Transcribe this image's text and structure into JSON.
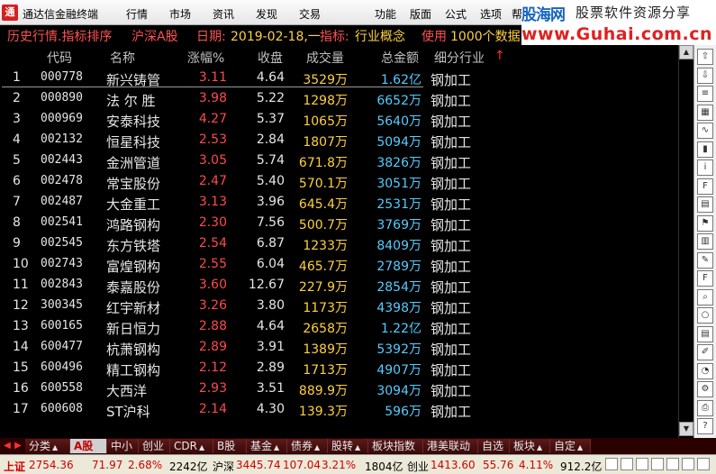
{
  "app": {
    "title": "通达信金融终端",
    "logo_glyph": "通"
  },
  "menu": [
    "行情",
    "市场",
    "资讯",
    "发现",
    "交易",
    "功能",
    "版面",
    "公式",
    "选项",
    "帮"
  ],
  "watermark": {
    "logo_a": "股海网",
    "logo_b": "股票软件资源分享",
    "url": "www.Guhai.com.cn"
  },
  "titlebar": {
    "section": "历史行情.指标排序",
    "market": "沪深A股",
    "date_label": "日期:",
    "date_value": "2019-02-18,一",
    "indicator_label": "指标:",
    "indicator_value": "行业概念",
    "usage_label": "使用",
    "usage_value": "1000个数据"
  },
  "columns": {
    "code": "代码",
    "name": "名称",
    "change": "涨幅%",
    "close": "收盘",
    "volume": "成交量",
    "amount": "总金额",
    "industry": "细分行业",
    "sort_marker": "↑"
  },
  "rows": [
    {
      "idx": "1",
      "code": "000778",
      "name": "新兴铸管",
      "change": "3.11",
      "close": "4.64",
      "volume": "3529万",
      "amount": "1.62亿",
      "industry": "钢加工"
    },
    {
      "idx": "2",
      "code": "000890",
      "name": "法 尔 胜",
      "change": "3.98",
      "close": "5.22",
      "volume": "1298万",
      "amount": "6652万",
      "industry": "钢加工"
    },
    {
      "idx": "3",
      "code": "000969",
      "name": "安泰科技",
      "change": "4.27",
      "close": "5.37",
      "volume": "1065万",
      "amount": "5640万",
      "industry": "钢加工"
    },
    {
      "idx": "4",
      "code": "002132",
      "name": "恒星科技",
      "change": "2.53",
      "close": "2.84",
      "volume": "1807万",
      "amount": "5094万",
      "industry": "钢加工"
    },
    {
      "idx": "5",
      "code": "002443",
      "name": "金洲管道",
      "change": "3.05",
      "close": "5.74",
      "volume": "671.8万",
      "amount": "3826万",
      "industry": "钢加工"
    },
    {
      "idx": "6",
      "code": "002478",
      "name": "常宝股份",
      "change": "2.47",
      "close": "5.40",
      "volume": "570.1万",
      "amount": "3051万",
      "industry": "钢加工"
    },
    {
      "idx": "7",
      "code": "002487",
      "name": "大金重工",
      "change": "3.13",
      "close": "3.96",
      "volume": "645.4万",
      "amount": "2531万",
      "industry": "钢加工"
    },
    {
      "idx": "8",
      "code": "002541",
      "name": "鸿路钢构",
      "change": "2.30",
      "close": "7.56",
      "volume": "500.7万",
      "amount": "3769万",
      "industry": "钢加工"
    },
    {
      "idx": "9",
      "code": "002545",
      "name": "东方铁塔",
      "change": "2.54",
      "close": "6.87",
      "volume": "1233万",
      "amount": "8409万",
      "industry": "钢加工"
    },
    {
      "idx": "10",
      "code": "002743",
      "name": "富煌钢构",
      "change": "2.55",
      "close": "6.04",
      "volume": "465.7万",
      "amount": "2789万",
      "industry": "钢加工"
    },
    {
      "idx": "11",
      "code": "002843",
      "name": "泰嘉股份",
      "change": "3.60",
      "close": "12.67",
      "volume": "227.9万",
      "amount": "2854万",
      "industry": "钢加工"
    },
    {
      "idx": "12",
      "code": "300345",
      "name": "红宇新材",
      "change": "3.26",
      "close": "3.80",
      "volume": "1173万",
      "amount": "4398万",
      "industry": "钢加工"
    },
    {
      "idx": "13",
      "code": "600165",
      "name": "新日恒力",
      "change": "2.88",
      "close": "4.64",
      "volume": "2658万",
      "amount": "1.22亿",
      "industry": "钢加工"
    },
    {
      "idx": "14",
      "code": "600477",
      "name": "杭萧钢构",
      "change": "2.89",
      "close": "3.91",
      "volume": "1389万",
      "amount": "5392万",
      "industry": "钢加工"
    },
    {
      "idx": "15",
      "code": "600496",
      "name": "精工钢构",
      "change": "2.12",
      "close": "2.89",
      "volume": "1713万",
      "amount": "4907万",
      "industry": "钢加工"
    },
    {
      "idx": "16",
      "code": "600558",
      "name": "大西洋",
      "change": "2.93",
      "close": "3.51",
      "volume": "889.9万",
      "amount": "3094万",
      "industry": "钢加工"
    },
    {
      "idx": "17",
      "code": "600608",
      "name": "ST沪科",
      "change": "2.14",
      "close": "4.30",
      "volume": "139.3万",
      "amount": "596万",
      "industry": "钢加工"
    }
  ],
  "sidebar_icons": [
    "arrow-up-icon",
    "arrow-down-icon",
    "list-icon",
    "table-icon",
    "chart-icon",
    "candle-icon",
    "info-icon",
    "f10-icon",
    "page-icon",
    "flag-icon",
    "book-icon",
    "note-icon",
    "fiz-icon",
    "search-icon",
    "circle-icon",
    "doc-icon",
    "edit-icon",
    "pie-icon",
    "settings-icon",
    "print-icon",
    "help-icon"
  ],
  "scroll": {
    "up": "▲",
    "down": "▼"
  },
  "tabs": [
    {
      "label": "分类",
      "drop": "▲",
      "active": false
    },
    {
      "label": "A股",
      "drop": "",
      "active": true
    },
    {
      "label": "中小",
      "drop": "",
      "active": false
    },
    {
      "label": "创业",
      "drop": "",
      "active": false
    },
    {
      "label": "CDR",
      "drop": "▲",
      "active": false
    },
    {
      "label": "B股",
      "drop": "",
      "active": false
    },
    {
      "label": "基金",
      "drop": "▲",
      "active": false
    },
    {
      "label": "债券",
      "drop": "▲",
      "active": false
    },
    {
      "label": "股转",
      "drop": "▲",
      "active": false
    },
    {
      "label": "板块指数",
      "drop": "",
      "active": false
    },
    {
      "label": "港美联动",
      "drop": "",
      "active": false
    },
    {
      "label": "自选",
      "drop": "",
      "active": false
    },
    {
      "label": "板块",
      "drop": "▲",
      "active": false
    },
    {
      "label": "自定",
      "drop": "▲",
      "active": false
    }
  ],
  "nav_arrows": {
    "left": "◀",
    "right": "▶"
  },
  "status": {
    "sh_label": "上证",
    "sh_index": "2754.36",
    "sh_change": "71.97",
    "sh_pct": "2.68%",
    "sh_amount": "2242亿",
    "sz_label": "沪深",
    "sz_index": "3445.74",
    "sz_change": "107.04",
    "sz_pct": "3.21%",
    "sz_amount": "1804亿",
    "cy_label": "创业",
    "cy_index": "1413.60",
    "cy_change": "55.76",
    "cy_pct": "4.11%",
    "cy_amount": "912.2亿"
  },
  "colors": {
    "up": "#ff4a4a",
    "volume": "#ffd040",
    "amount": "#55ccff",
    "text": "#e6e6e6",
    "title": "#ff5050"
  }
}
